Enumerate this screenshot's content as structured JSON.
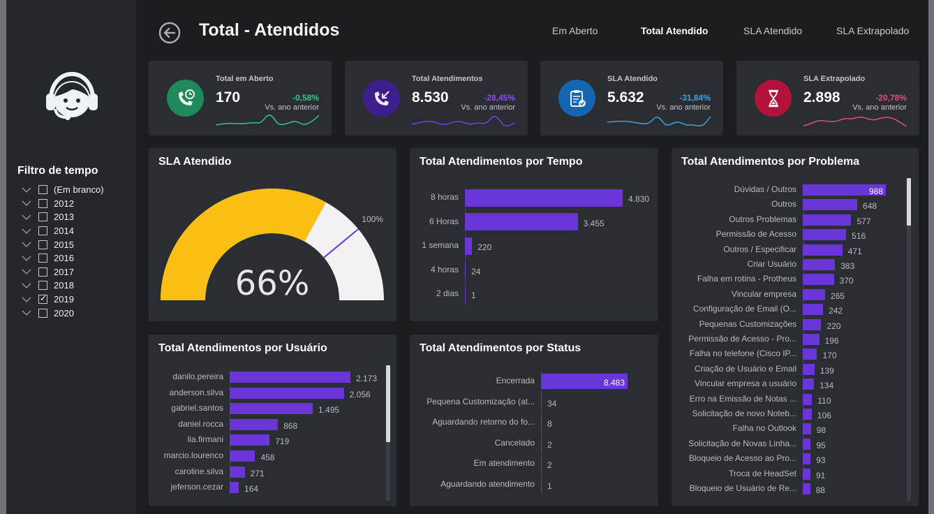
{
  "header": {
    "title": "Total - Atendidos",
    "tabs": [
      {
        "label": "Em Aberto",
        "active": false
      },
      {
        "label": "Total Atendido",
        "active": true
      },
      {
        "label": "SLA Atendido",
        "active": false
      },
      {
        "label": "SLA Extrapolado",
        "active": false
      }
    ]
  },
  "sidebar": {
    "filter_title": "Filtro de tempo",
    "filters": [
      {
        "label": "(Em branco)",
        "checked": false
      },
      {
        "label": "2012",
        "checked": false
      },
      {
        "label": "2013",
        "checked": false
      },
      {
        "label": "2014",
        "checked": false
      },
      {
        "label": "2015",
        "checked": false
      },
      {
        "label": "2016",
        "checked": false
      },
      {
        "label": "2017",
        "checked": false
      },
      {
        "label": "2018",
        "checked": false
      },
      {
        "label": "2019",
        "checked": true
      },
      {
        "label": "2020",
        "checked": false
      }
    ]
  },
  "kpis": [
    {
      "label": "Total em Aberto",
      "value": "170",
      "delta": "-0,58%",
      "sub": "Vs. ano anterior",
      "icon": "phone-clock-icon",
      "icon_bg": "#1e8a5a",
      "color": "#33c98a"
    },
    {
      "label": "Total Atendimentos",
      "value": "8.530",
      "delta": "-28,45%",
      "sub": "Vs. ano anterior",
      "icon": "incoming-call-icon",
      "icon_bg": "#3d1f8c",
      "color": "#8a4df0"
    },
    {
      "label": "SLA Atendido",
      "value": "5.632",
      "delta": "-31,84%",
      "sub": "Vs. ano anterior",
      "icon": "clipboard-check-icon",
      "icon_bg": "#1466b0",
      "color": "#3fa2e8"
    },
    {
      "label": "SLA Extrapolado",
      "value": "2.898",
      "delta": "-20,78%",
      "sub": "Vs. ano anterior",
      "icon": "hourglass-icon",
      "icon_bg": "#b3133a",
      "color": "#e44c78"
    }
  ],
  "chart_data": [
    {
      "type": "gauge",
      "title": "SLA Atendido",
      "value": 66,
      "value_label": "66%",
      "target_label": "100%",
      "colors": {
        "fill": "#fbbf14",
        "rest": "#f2f2f2",
        "target": "#6a35d9"
      }
    },
    {
      "type": "bar",
      "orientation": "horizontal",
      "title": "Total Atendimentos por Tempo",
      "categories": [
        "8 horas",
        "6 Horas",
        "1 semana",
        "4 horas",
        "2 dias"
      ],
      "values": [
        4830,
        3455,
        220,
        24,
        1
      ],
      "value_labels": [
        "4.830",
        "3.455",
        "220",
        "24",
        "1"
      ]
    },
    {
      "type": "bar",
      "orientation": "horizontal",
      "title": "Total Atendimentos por Problema",
      "categories": [
        "Dúvidas / Outros",
        "Outros",
        "Outros Problemas",
        "Permissão de Acesso",
        "Outros / Especificar",
        "Criar Usuário",
        "Falha em rotina - Protheus",
        "Vincular empresa",
        "Configuração de Email (O...",
        "Pequenas Customizações",
        "Permissão de Acesso - Pro...",
        "Falha no telefone (Cisco IP...",
        "Criação de Usuário e Email",
        "Vincular empresa a usuário",
        "Erro na Emissão de Notas ...",
        "Solicitação de novo Noteb...",
        "Falha no Outlook",
        "Solicitação de Novas Linha...",
        "Bloqueio de Acesso ao Pro...",
        "Troca de HeadSet",
        "Bloqueio de Usuário de Re..."
      ],
      "values": [
        988,
        648,
        577,
        516,
        471,
        383,
        370,
        265,
        242,
        220,
        196,
        170,
        139,
        134,
        110,
        106,
        98,
        95,
        93,
        91,
        88
      ],
      "value_labels": [
        "988",
        "648",
        "577",
        "516",
        "471",
        "383",
        "370",
        "265",
        "242",
        "220",
        "196",
        "170",
        "139",
        "134",
        "110",
        "106",
        "98",
        "95",
        "93",
        "91",
        "88"
      ]
    },
    {
      "type": "bar",
      "orientation": "horizontal",
      "title": "Total Atendimentos por Usuário",
      "categories": [
        "danilo.pereira",
        "anderson.silva",
        "gabriel.santos",
        "daniel.rocca",
        "lia.firmani",
        "marcio.lourenco",
        "caroline.silva",
        "jeferson.cezar"
      ],
      "values": [
        2173,
        2056,
        1495,
        868,
        719,
        458,
        271,
        164
      ],
      "value_labels": [
        "2.173",
        "2.056",
        "1.495",
        "868",
        "719",
        "458",
        "271",
        "164"
      ]
    },
    {
      "type": "bar",
      "orientation": "horizontal",
      "title": "Total Atendimentos por Status",
      "categories": [
        "Encerrada",
        "Pequena Customização (at...",
        "Aguardando retorno do fo...",
        "Cancelado",
        "Em atendimento",
        "Aguardando atendimento"
      ],
      "values": [
        8483,
        34,
        8,
        2,
        2,
        1
      ],
      "value_labels": [
        "8.483",
        "34",
        "8",
        "2",
        "2",
        "1"
      ]
    }
  ]
}
